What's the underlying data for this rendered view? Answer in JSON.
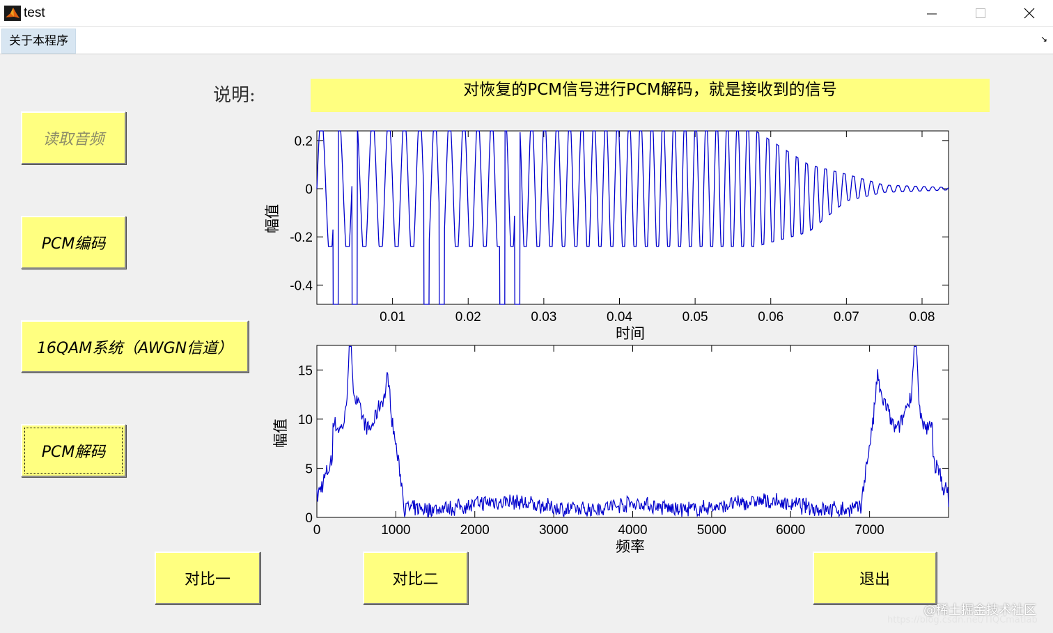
{
  "window": {
    "title": "test",
    "minimize_icon": "minimize-icon",
    "maximize_icon": "maximize-icon",
    "close_icon": "close-icon"
  },
  "menu": {
    "about": "关于本程序"
  },
  "buttons": {
    "read_audio": "读取音频",
    "pcm_encode": "PCM编码",
    "qam": "16QAM系统（AWGN信道）",
    "pcm_decode": "PCM解码",
    "compare1": "对比一",
    "compare2": "对比二",
    "exit": "退出"
  },
  "description": {
    "label": "说明:",
    "text": "对恢复的PCM信号进行PCM解码，就是接收到的信号"
  },
  "colors": {
    "button_bg": "#ffff80",
    "plot_line": "#0000cc"
  },
  "chart_data": [
    {
      "type": "line",
      "xlabel": "时间",
      "ylabel": "幅值",
      "xlim": [
        0,
        0.0835
      ],
      "ylim": [
        -0.48,
        0.24
      ],
      "xticks": [
        0.01,
        0.02,
        0.03,
        0.04,
        0.05,
        0.06,
        0.07,
        0.08
      ],
      "yticks": [
        0.2,
        0,
        -0.2,
        -0.4
      ],
      "xtick_labels": [
        "0.01",
        "0.02",
        "0.03",
        "0.04",
        "0.05",
        "0.06",
        "0.07",
        "0.08"
      ],
      "ytick_labels": [
        "0.2",
        "0",
        "-0.2",
        "-0.4"
      ],
      "series": [
        {
          "color": "#0000cc",
          "description_of_shape": "clipped oscillation"
        }
      ],
      "envelope": {
        "t": [
          0,
          0.058,
          0.065,
          0.07,
          0.075,
          0.0835
        ],
        "upper": [
          0.24,
          0.24,
          0.1,
          0.06,
          0.015,
          0.005
        ],
        "lower": [
          -0.24,
          -0.24,
          -0.18,
          -0.05,
          -0.015,
          -0.005
        ]
      },
      "frequency_hz_start": 420,
      "frequency_hz_end": 900,
      "deep_spikes_t": [
        0.0025,
        0.005,
        0.0145,
        0.0165,
        0.0245,
        0.0265
      ]
    },
    {
      "type": "line",
      "xlabel": "频率",
      "ylabel": "幅值",
      "xlim": [
        0,
        8000
      ],
      "ylim": [
        0,
        17.5
      ],
      "xticks": [
        0,
        1000,
        2000,
        3000,
        4000,
        5000,
        6000,
        7000
      ],
      "yticks": [
        0,
        5,
        10,
        15
      ],
      "xtick_labels": [
        "0",
        "1000",
        "2000",
        "3000",
        "4000",
        "5000",
        "6000",
        "7000"
      ],
      "ytick_labels": [
        "0",
        "5",
        "10",
        "15"
      ],
      "peaks": [
        {
          "x": 420,
          "y": 17.3
        },
        {
          "x": 900,
          "y": 13.3
        },
        {
          "x": 7100,
          "y": 13.3
        },
        {
          "x": 7580,
          "y": 17.3
        }
      ],
      "noise_floor": 1.2
    }
  ],
  "watermark": {
    "line1": "@稀土掘金技术社区",
    "line2": "https://blog.csdn.net/TIQCmatlab"
  }
}
